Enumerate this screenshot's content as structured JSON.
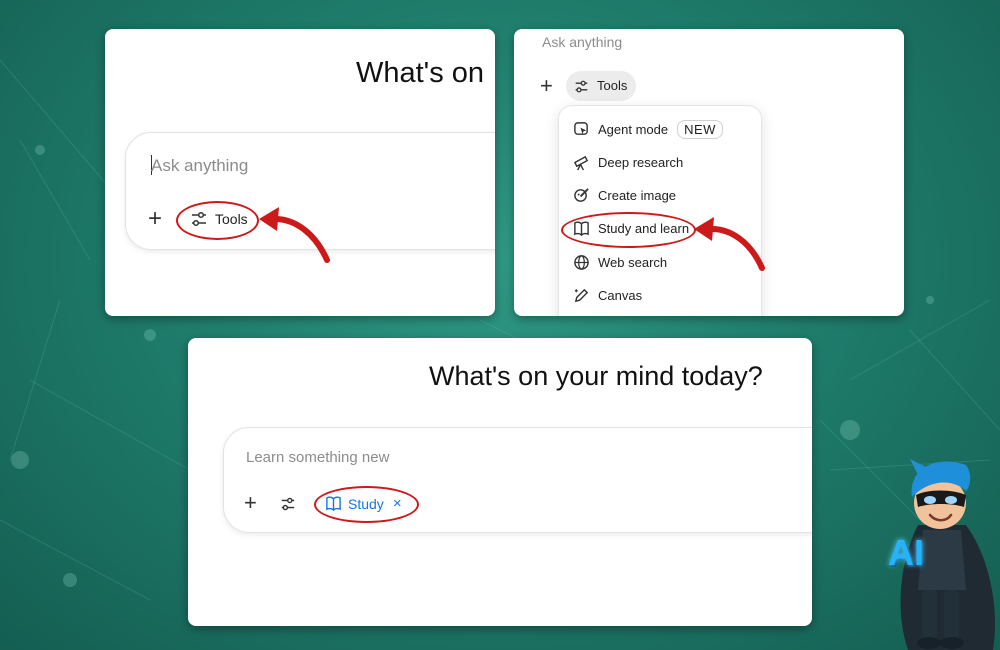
{
  "panel1": {
    "heading": "What's on",
    "placeholder": "Ask anything",
    "tools_label": "Tools"
  },
  "panel2": {
    "placeholder": "Ask anything",
    "tools_label": "Tools",
    "menu_items": [
      {
        "label": "Agent mode",
        "icon": "agent-icon",
        "badge": "NEW"
      },
      {
        "label": "Deep research",
        "icon": "telescope-icon"
      },
      {
        "label": "Create image",
        "icon": "image-brush-icon"
      },
      {
        "label": "Study and learn",
        "icon": "book-icon"
      },
      {
        "label": "Web search",
        "icon": "globe-icon"
      },
      {
        "label": "Canvas",
        "icon": "pen-icon"
      }
    ]
  },
  "panel3": {
    "heading": "What's on your mind today?",
    "placeholder": "Learn something new",
    "chip_label": "Study",
    "chip_close": "×"
  },
  "mascot": {
    "badge_text": "AI"
  },
  "colors": {
    "highlight": "#cc1a1a",
    "chip_blue": "#1a73e8",
    "background": "#1f7d6c"
  }
}
